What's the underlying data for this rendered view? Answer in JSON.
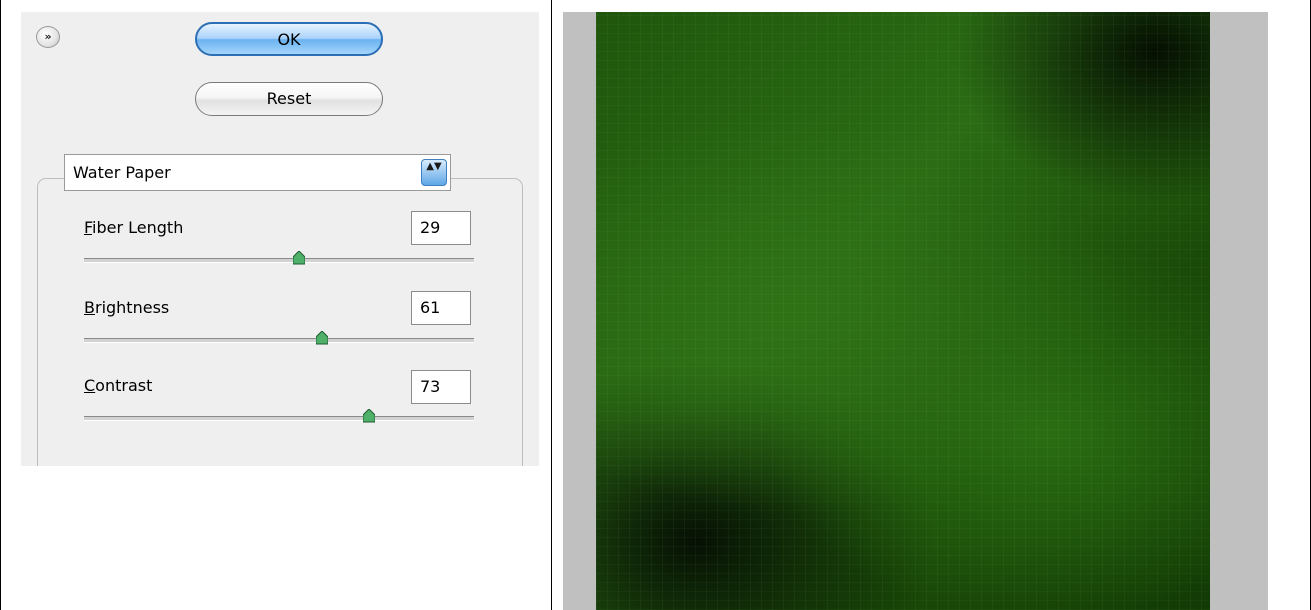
{
  "dialog": {
    "collapse_glyph": "»",
    "ok_label": "OK",
    "reset_label": "Reset",
    "filter_select": {
      "value": "Water Paper",
      "arrows": "▲▼"
    },
    "params": [
      {
        "mnemonic": "F",
        "rest": "iber Length",
        "value": "29",
        "level": 0.55
      },
      {
        "mnemonic": "B",
        "rest": "rightness",
        "value": "61",
        "level": 0.61
      },
      {
        "mnemonic": "C",
        "rest": "ontrast",
        "value": "73",
        "level": 0.73
      }
    ]
  },
  "preview": {
    "description_icon": "green-textured-image"
  },
  "colors": {
    "ok_accent": "#6ab2f1",
    "canvas_border": "#c0c0c0",
    "texture_green": "#2b6c14"
  }
}
